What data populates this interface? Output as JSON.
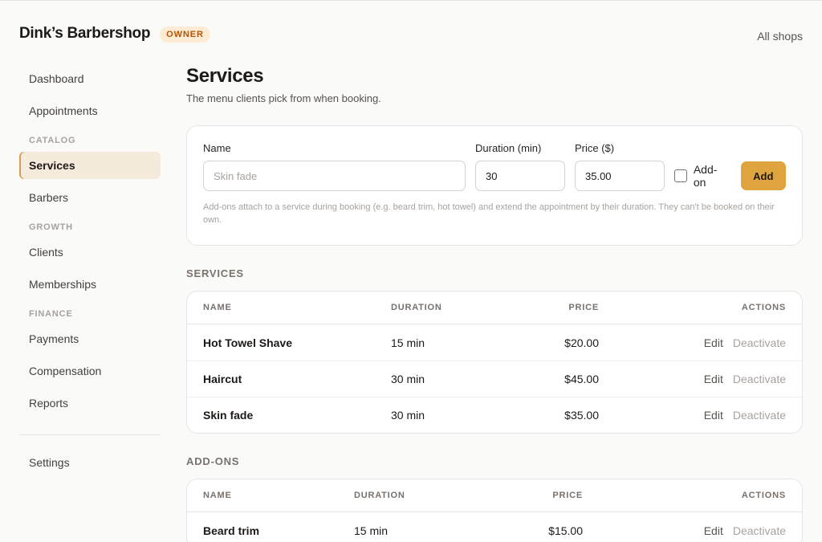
{
  "header": {
    "shop_name": "Dink’s Barbershop",
    "role_badge": "OWNER",
    "all_shops": "All shops"
  },
  "sidebar": {
    "items": [
      {
        "label": "Dashboard"
      },
      {
        "label": "Appointments"
      },
      {
        "group": "CATALOG"
      },
      {
        "label": "Services",
        "active": true
      },
      {
        "label": "Barbers"
      },
      {
        "group": "GROWTH"
      },
      {
        "label": "Clients"
      },
      {
        "label": "Memberships"
      },
      {
        "group": "FINANCE"
      },
      {
        "label": "Payments"
      },
      {
        "label": "Compensation"
      },
      {
        "label": "Reports"
      }
    ],
    "settings": "Settings"
  },
  "page": {
    "title": "Services",
    "subtitle": "The menu clients pick from when booking."
  },
  "form": {
    "name_label": "Name",
    "name_placeholder": "Skin fade",
    "name_value": "",
    "duration_label": "Duration (min)",
    "duration_value": "30",
    "price_label": "Price ($)",
    "price_value": "35.00",
    "addon_label": "Add-on",
    "addon_checked": false,
    "add_button": "Add",
    "hint": "Add-ons attach to a service during booking (e.g. beard trim, hot towel) and extend the appointment by their duration. They can't be booked on their own."
  },
  "services": {
    "section_title": "SERVICES",
    "columns": [
      "NAME",
      "DURATION",
      "PRICE",
      "ACTIONS"
    ],
    "rows": [
      {
        "name": "Hot Towel Shave",
        "duration": "15 min",
        "price": "$20.00"
      },
      {
        "name": "Haircut",
        "duration": "30 min",
        "price": "$45.00"
      },
      {
        "name": "Skin fade",
        "duration": "30 min",
        "price": "$35.00"
      }
    ]
  },
  "addons": {
    "section_title": "ADD-ONS",
    "columns": [
      "NAME",
      "DURATION",
      "PRICE",
      "ACTIONS"
    ],
    "rows": [
      {
        "name": "Beard trim",
        "duration": "15 min",
        "price": "$15.00"
      }
    ]
  },
  "actions": {
    "edit": "Edit",
    "deactivate": "Deactivate"
  },
  "colors": {
    "accent": "#e0a43e",
    "active_nav_bg": "#f5ebdc",
    "badge_text": "#b45309"
  }
}
